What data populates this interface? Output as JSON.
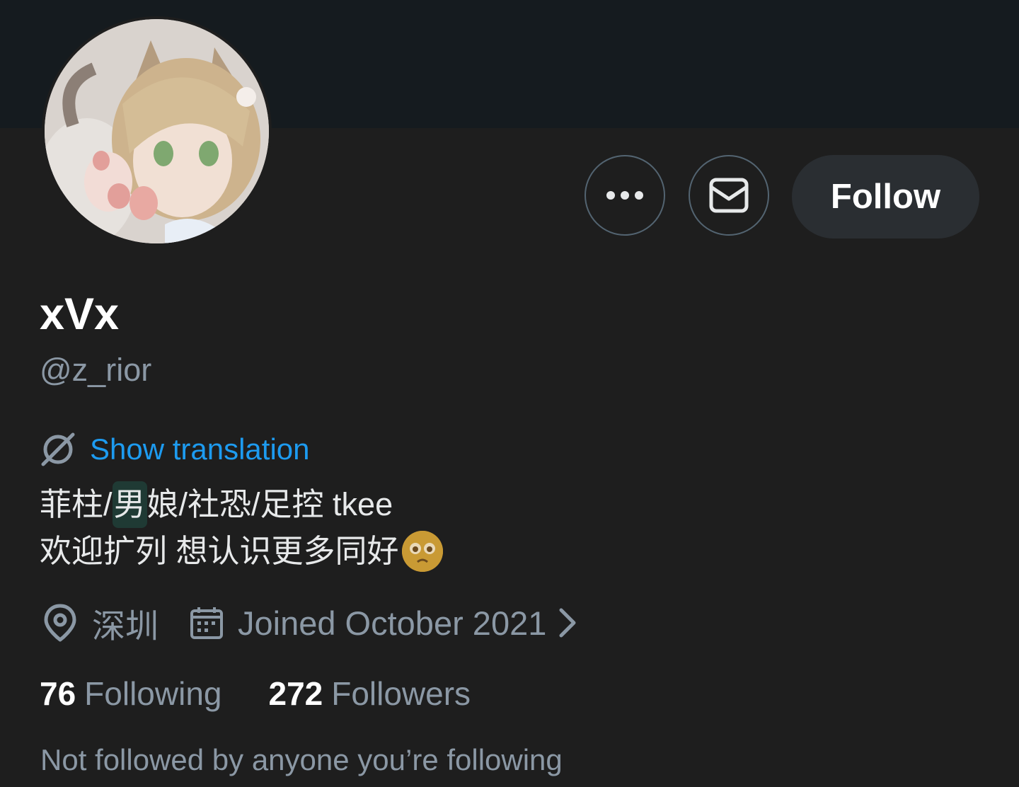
{
  "profile": {
    "display_name": "xVx",
    "handle": "@z_rior",
    "avatar_alt": "anime cat-girl avatar"
  },
  "actions": {
    "more_icon": "more-horizontal-icon",
    "message_icon": "envelope-icon",
    "follow_label": "Follow"
  },
  "translation": {
    "icon": "translate-icon",
    "label": "Show translation"
  },
  "bio": {
    "line1_part1": "菲柱/",
    "line1_highlight": "男",
    "line1_part2": "娘/社恐/足控 tkee",
    "line2_text": "欢迎扩列 想认识更多同好",
    "line2_emoji": "pleading-face-emoji"
  },
  "meta": {
    "location_icon": "location-pin-icon",
    "location": "深圳",
    "calendar_icon": "calendar-icon",
    "joined": "Joined October 2021",
    "joined_chevron": "chevron-right-icon"
  },
  "stats": {
    "following_count": "76",
    "following_label": "Following",
    "followers_count": "272",
    "followers_label": "Followers"
  },
  "social_context": "Not followed by anyone you’re following",
  "colors": {
    "background": "#1e1e1e",
    "banner": "#151b1f",
    "link": "#1d9bf0",
    "secondary_text": "#8b98a5",
    "follow_button_bg": "#2a2e32"
  }
}
